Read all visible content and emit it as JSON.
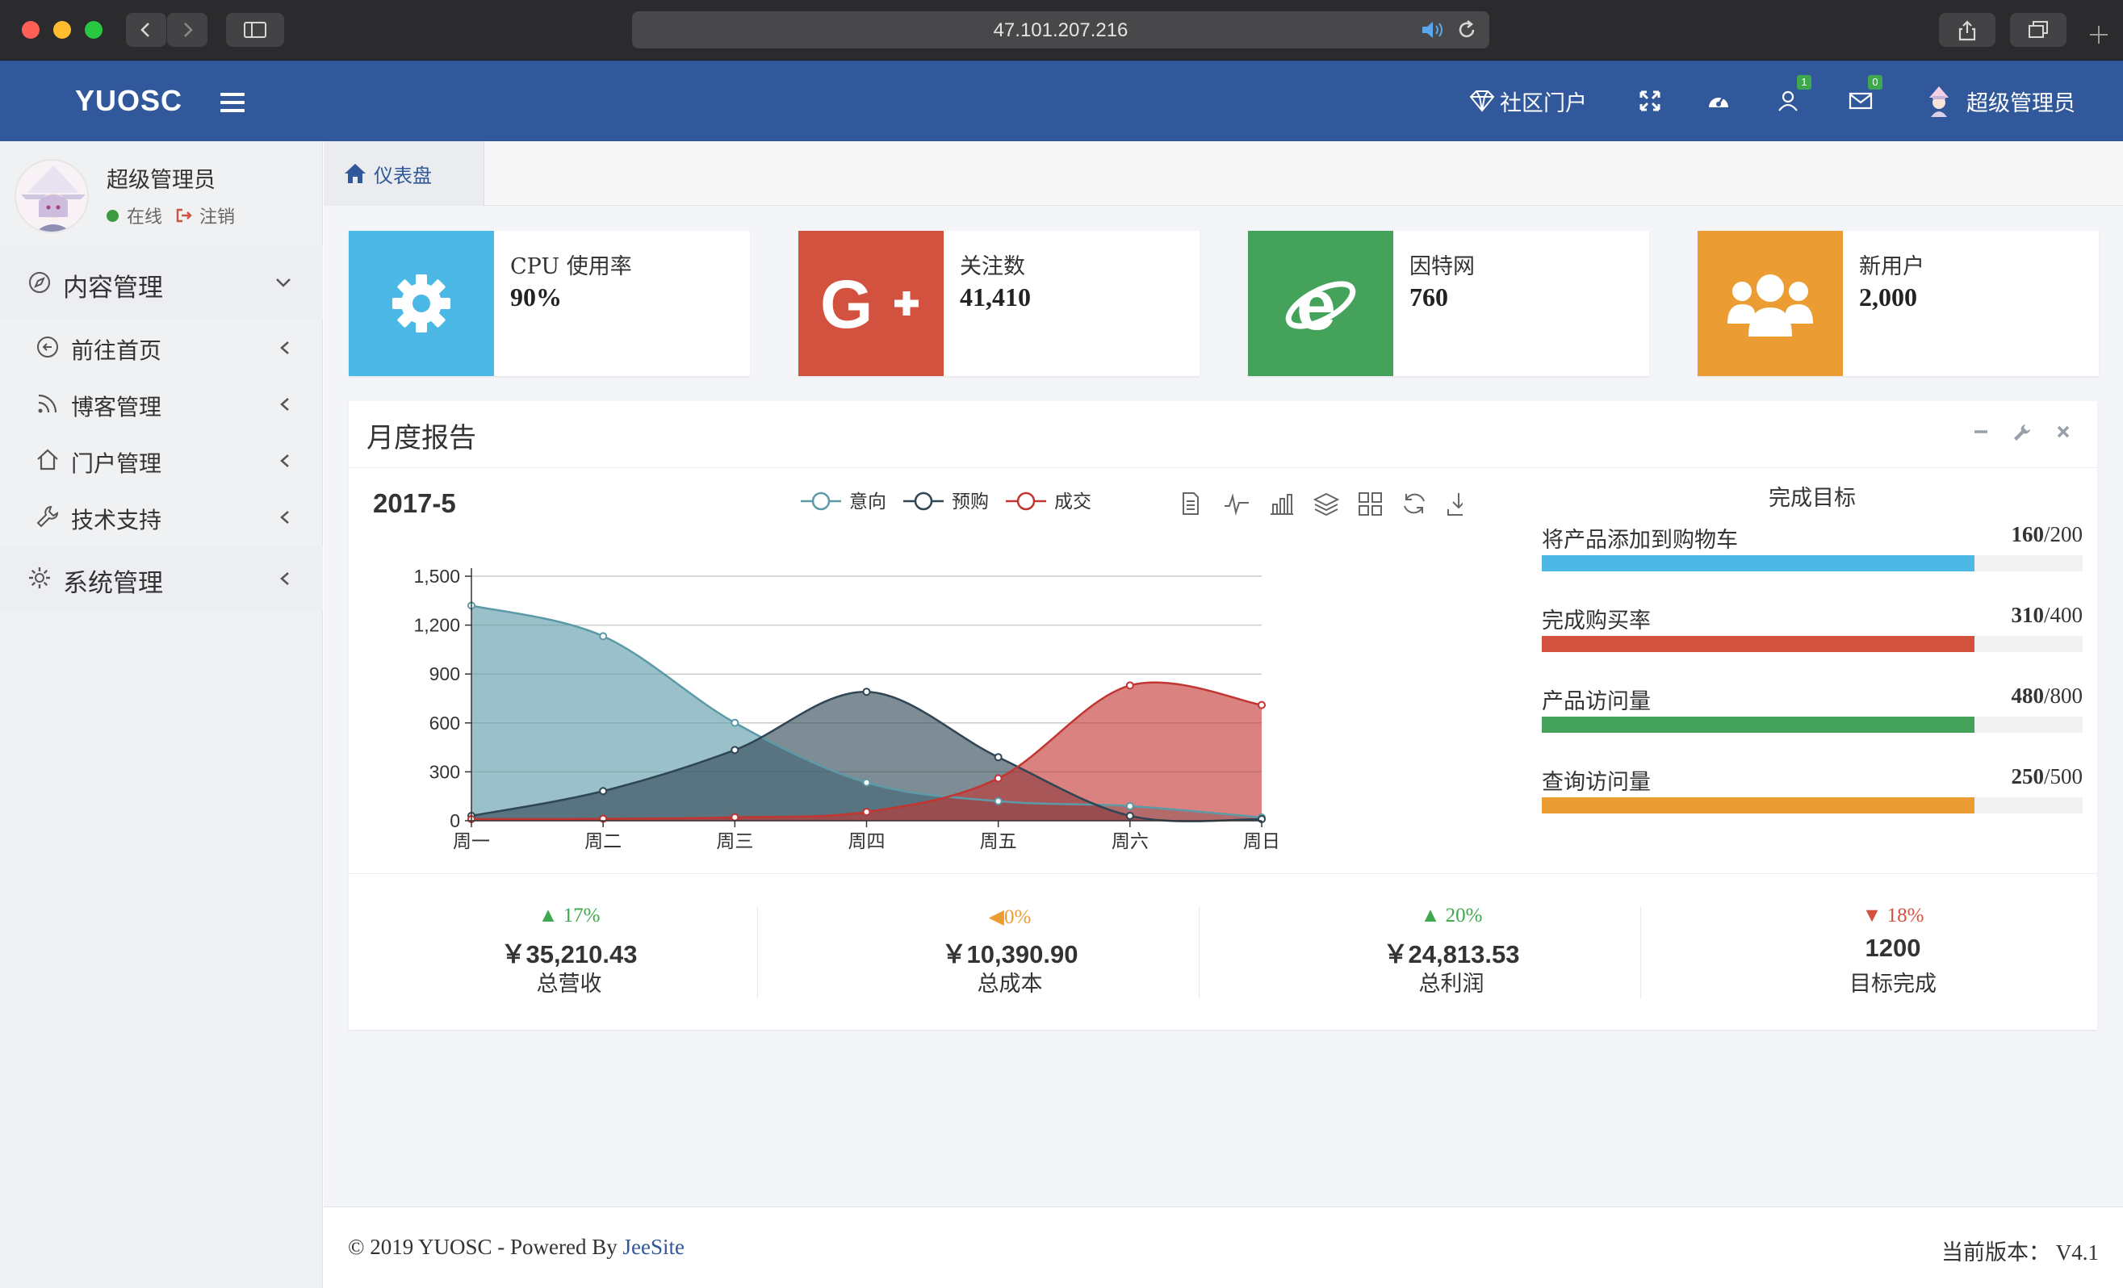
{
  "browser": {
    "url": "47.101.207.216"
  },
  "header": {
    "logo": "YUOSC",
    "portal_label": "社区门户",
    "user_badge": "1",
    "mail_badge": "0",
    "user_name": "超级管理员"
  },
  "sidebar": {
    "user_name": "超级管理员",
    "status": "在线",
    "logout": "注销",
    "items": [
      {
        "label": "内容管理",
        "icon": "compass-icon"
      },
      {
        "label": "前往首页",
        "icon": "arrow-left-circle-icon"
      },
      {
        "label": "博客管理",
        "icon": "rss-icon"
      },
      {
        "label": "门户管理",
        "icon": "home-icon"
      },
      {
        "label": "技术支持",
        "icon": "wrench-icon"
      },
      {
        "label": "系统管理",
        "icon": "gear-icon"
      }
    ]
  },
  "tabs": {
    "dashboard": "仪表盘"
  },
  "info_boxes": [
    {
      "title": "CPU 使用率",
      "value": "90%",
      "color": "#4cb8e6",
      "icon": "gear-icon"
    },
    {
      "title": "关注数",
      "value": "41,410",
      "color": "#d2513f",
      "icon": "google-plus-icon"
    },
    {
      "title": "因特网",
      "value": "760",
      "color": "#44a25a",
      "icon": "internet-explorer-icon"
    },
    {
      "title": "新用户",
      "value": "2,000",
      "color": "#eb9d34",
      "icon": "users-icon"
    }
  ],
  "report": {
    "title": "月度报告",
    "period": "2017-5",
    "goals_title": "完成目标",
    "goals": [
      {
        "label": "将产品添加到购物车",
        "done": "160",
        "total": "/200",
        "percent": 80,
        "color": "#4cb8e6"
      },
      {
        "label": "完成购买率",
        "done": "310",
        "total": "/400",
        "percent": 80,
        "color": "#d2513f"
      },
      {
        "label": "产品访问量",
        "done": "480",
        "total": "/800",
        "percent": 80,
        "color": "#44a25a"
      },
      {
        "label": "查询访问量",
        "done": "250",
        "total": "/500",
        "percent": 80,
        "color": "#eb9d34"
      }
    ]
  },
  "stats": [
    {
      "change": "17%",
      "direction": "up",
      "amount": "￥35,210.43",
      "label": "总营收",
      "color": "#3fa84f"
    },
    {
      "change": "0%",
      "direction": "left",
      "amount": "￥10,390.90",
      "label": "总成本",
      "color": "#eb9d34"
    },
    {
      "change": "20%",
      "direction": "up",
      "amount": "￥24,813.53",
      "label": "总利润",
      "color": "#3fa84f"
    },
    {
      "change": "18%",
      "direction": "down",
      "amount": "1200",
      "label": "目标完成",
      "color": "#d2513f"
    }
  ],
  "footer": {
    "copyright": "© 2019 YUOSC - Powered By ",
    "link": "JeeSite",
    "version": "当前版本：  V4.1"
  },
  "chart_data": {
    "type": "area",
    "title": "2017-5",
    "categories": [
      "周一",
      "周二",
      "周三",
      "周四",
      "周五",
      "周六",
      "周日"
    ],
    "ylim": [
      0,
      1500
    ],
    "yticks": [
      "0",
      "300",
      "600",
      "900",
      "1,200",
      "1,500"
    ],
    "grid": true,
    "legend_position": "top",
    "series": [
      {
        "name": "意向",
        "values": [
          1320,
          1132,
          601,
          234,
          120,
          90,
          20
        ],
        "color": "#5c9aa8"
      },
      {
        "name": "预购",
        "values": [
          30,
          182,
          434,
          791,
          390,
          30,
          10
        ],
        "color": "#2f4554"
      },
      {
        "name": "成交",
        "values": [
          10,
          12,
          21,
          54,
          260,
          830,
          710
        ],
        "color": "#c23531"
      }
    ]
  }
}
